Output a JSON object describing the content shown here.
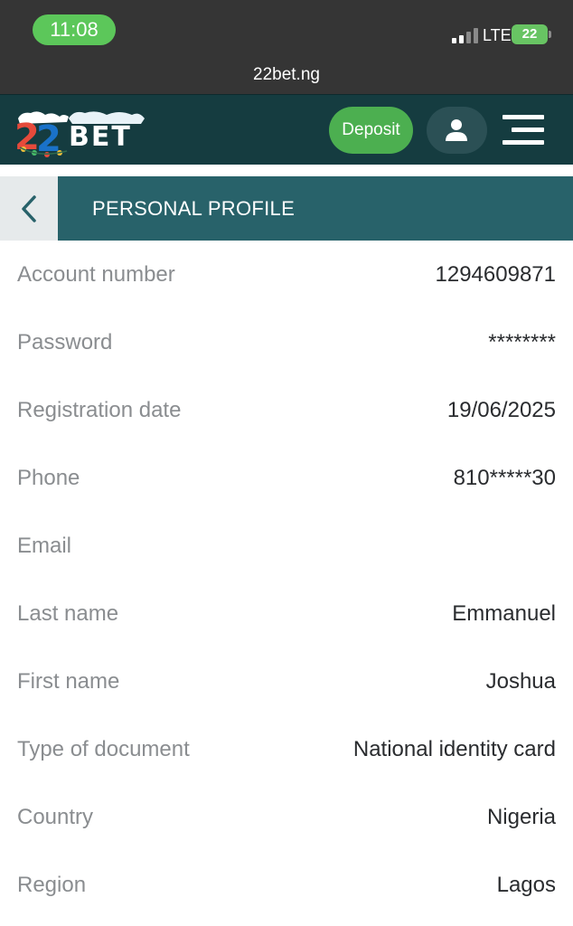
{
  "status_bar": {
    "time": "11:08",
    "network": "LTE",
    "battery": "22"
  },
  "browser": {
    "url": "22bet.ng"
  },
  "header": {
    "logo_text": "22BET",
    "deposit_label": "Deposit",
    "profile_icon": "user-icon",
    "menu_icon": "hamburger-menu-icon"
  },
  "page": {
    "title": "PERSONAL PROFILE",
    "back_icon": "chevron-left-icon"
  },
  "profile": {
    "rows": [
      {
        "label": "Account number",
        "value": "1294609871"
      },
      {
        "label": "Password",
        "value": "********"
      },
      {
        "label": "Registration date",
        "value": "19/06/2025"
      },
      {
        "label": "Phone",
        "value": "810*****30"
      },
      {
        "label": "Email",
        "value": ""
      },
      {
        "label": "Last name",
        "value": "Emmanuel"
      },
      {
        "label": "First name",
        "value": "Joshua"
      },
      {
        "label": "Type of document",
        "value": "National identity card"
      },
      {
        "label": "Country",
        "value": "Nigeria"
      },
      {
        "label": "Region",
        "value": "Lagos"
      }
    ]
  },
  "colors": {
    "status_bg": "#353535",
    "time_pill": "#5cc75a",
    "header_bg": "#153c40",
    "title_bar_bg": "#28626a",
    "deposit_green": "#4caf50",
    "label_gray": "#8a8d90",
    "value_dark": "#2a2c2f"
  }
}
